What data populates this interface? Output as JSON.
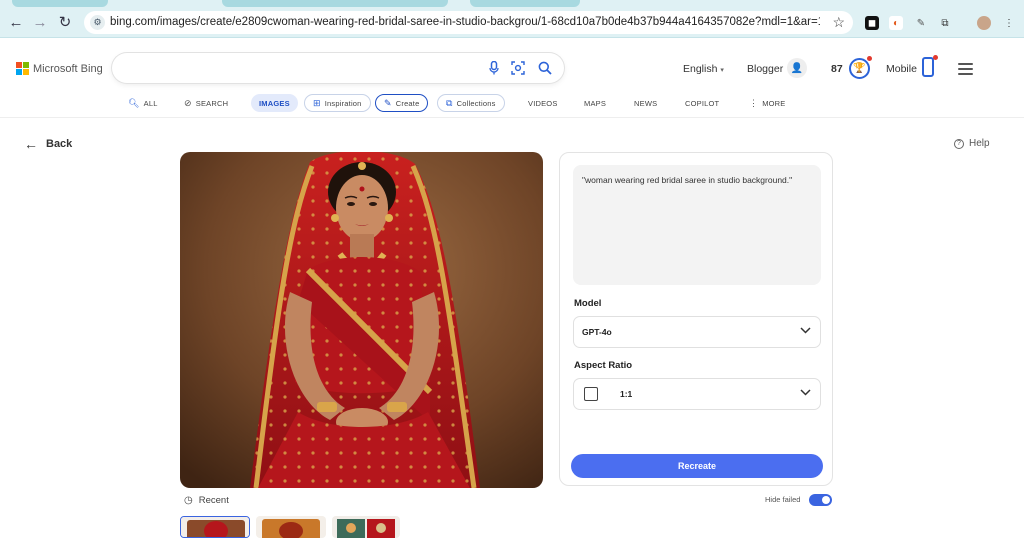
{
  "browser": {
    "url": "bing.com/images/create/e2809cwoman-wearing-red-bridal-saree-in-studio-backgrou/1-68cd10a7b0de4b37b944a4164357082e?mdl=1&ar=1&FORM=G..."
  },
  "header": {
    "logo_text": "Microsoft Bing",
    "search_placeholder": "",
    "language": "English",
    "account_label": "Blogger",
    "points": "87",
    "mobile_label": "Mobile"
  },
  "tabs": [
    {
      "label": "ALL",
      "icon": "search-icon"
    },
    {
      "label": "SEARCH",
      "icon": "copilot-search-icon"
    },
    {
      "label": "IMAGES",
      "icon": ""
    },
    {
      "label": "Inspiration",
      "icon": "inspiration-icon"
    },
    {
      "label": "Create",
      "icon": "create-icon"
    },
    {
      "label": "Collections",
      "icon": "collections-icon"
    },
    {
      "label": "VIDEOS",
      "icon": ""
    },
    {
      "label": "MAPS",
      "icon": ""
    },
    {
      "label": "NEWS",
      "icon": ""
    },
    {
      "label": "COPILOT",
      "icon": ""
    },
    {
      "label": "MORE",
      "icon": "more-dots-icon"
    }
  ],
  "main": {
    "back_label": "Back",
    "help_label": "Help",
    "prompt_text": "\"woman wearing red bridal saree in studio background.\"",
    "model_label": "Model",
    "model_value": "GPT-4o",
    "aspect_label": "Aspect Ratio",
    "aspect_value": "1:1",
    "recreate_label": "Recreate",
    "recent_label": "Recent",
    "hide_failed_label": "Hide failed"
  },
  "colors": {
    "accent": "#4b6ef0",
    "brand_blue": "#2c63d8",
    "saree_red": "#b5161c",
    "backdrop": "#6b4226"
  }
}
